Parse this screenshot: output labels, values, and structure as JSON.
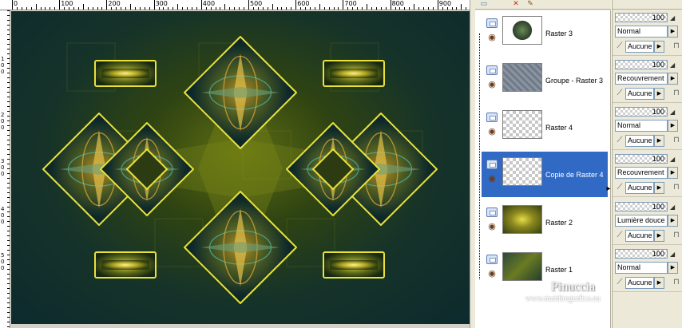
{
  "rulers": {
    "top": [
      "0",
      "100",
      "200",
      "300",
      "400",
      "500",
      "600",
      "700",
      "800",
      "900"
    ],
    "left": [
      "1",
      "0",
      "0",
      "2",
      "0",
      "0",
      "3",
      "0",
      "0",
      "4",
      "0",
      "0",
      "5",
      "0",
      "0"
    ]
  },
  "toolbar": {
    "icons": [
      "new-layer-icon",
      "delete-layer-icon",
      "edit-icon"
    ]
  },
  "layers": [
    {
      "name": "Raster 3",
      "thumb": "raster3",
      "selected": false
    },
    {
      "name": "Groupe - Raster 3",
      "thumb": "group",
      "selected": false
    },
    {
      "name": "Raster 4",
      "thumb": "raster4",
      "selected": false
    },
    {
      "name": "Copie de Raster 4",
      "thumb": "copy4",
      "selected": true
    },
    {
      "name": "Raster 2",
      "thumb": "raster2",
      "selected": false
    },
    {
      "name": "Raster 1",
      "thumb": "raster1",
      "selected": false
    }
  ],
  "properties": [
    {
      "opacity": "100",
      "blend": "Normal",
      "mask": "Aucune"
    },
    {
      "opacity": "100",
      "blend": "Recouvrement",
      "mask": "Aucune"
    },
    {
      "opacity": "100",
      "blend": "Normal",
      "mask": "Aucune"
    },
    {
      "opacity": "100",
      "blend": "Recouvrement",
      "mask": "Aucune"
    },
    {
      "opacity": "100",
      "blend": "Lumière douce",
      "mask": "Aucune"
    },
    {
      "opacity": "100",
      "blend": "Normal",
      "mask": "Aucune"
    }
  ],
  "watermark": {
    "name": "Pinuccia",
    "url": "www.maidiregrafica.eu"
  },
  "colors": {
    "selection": "#316ac5",
    "frame": "#e8e23a",
    "canvas_dark": "#0d2a2e"
  }
}
